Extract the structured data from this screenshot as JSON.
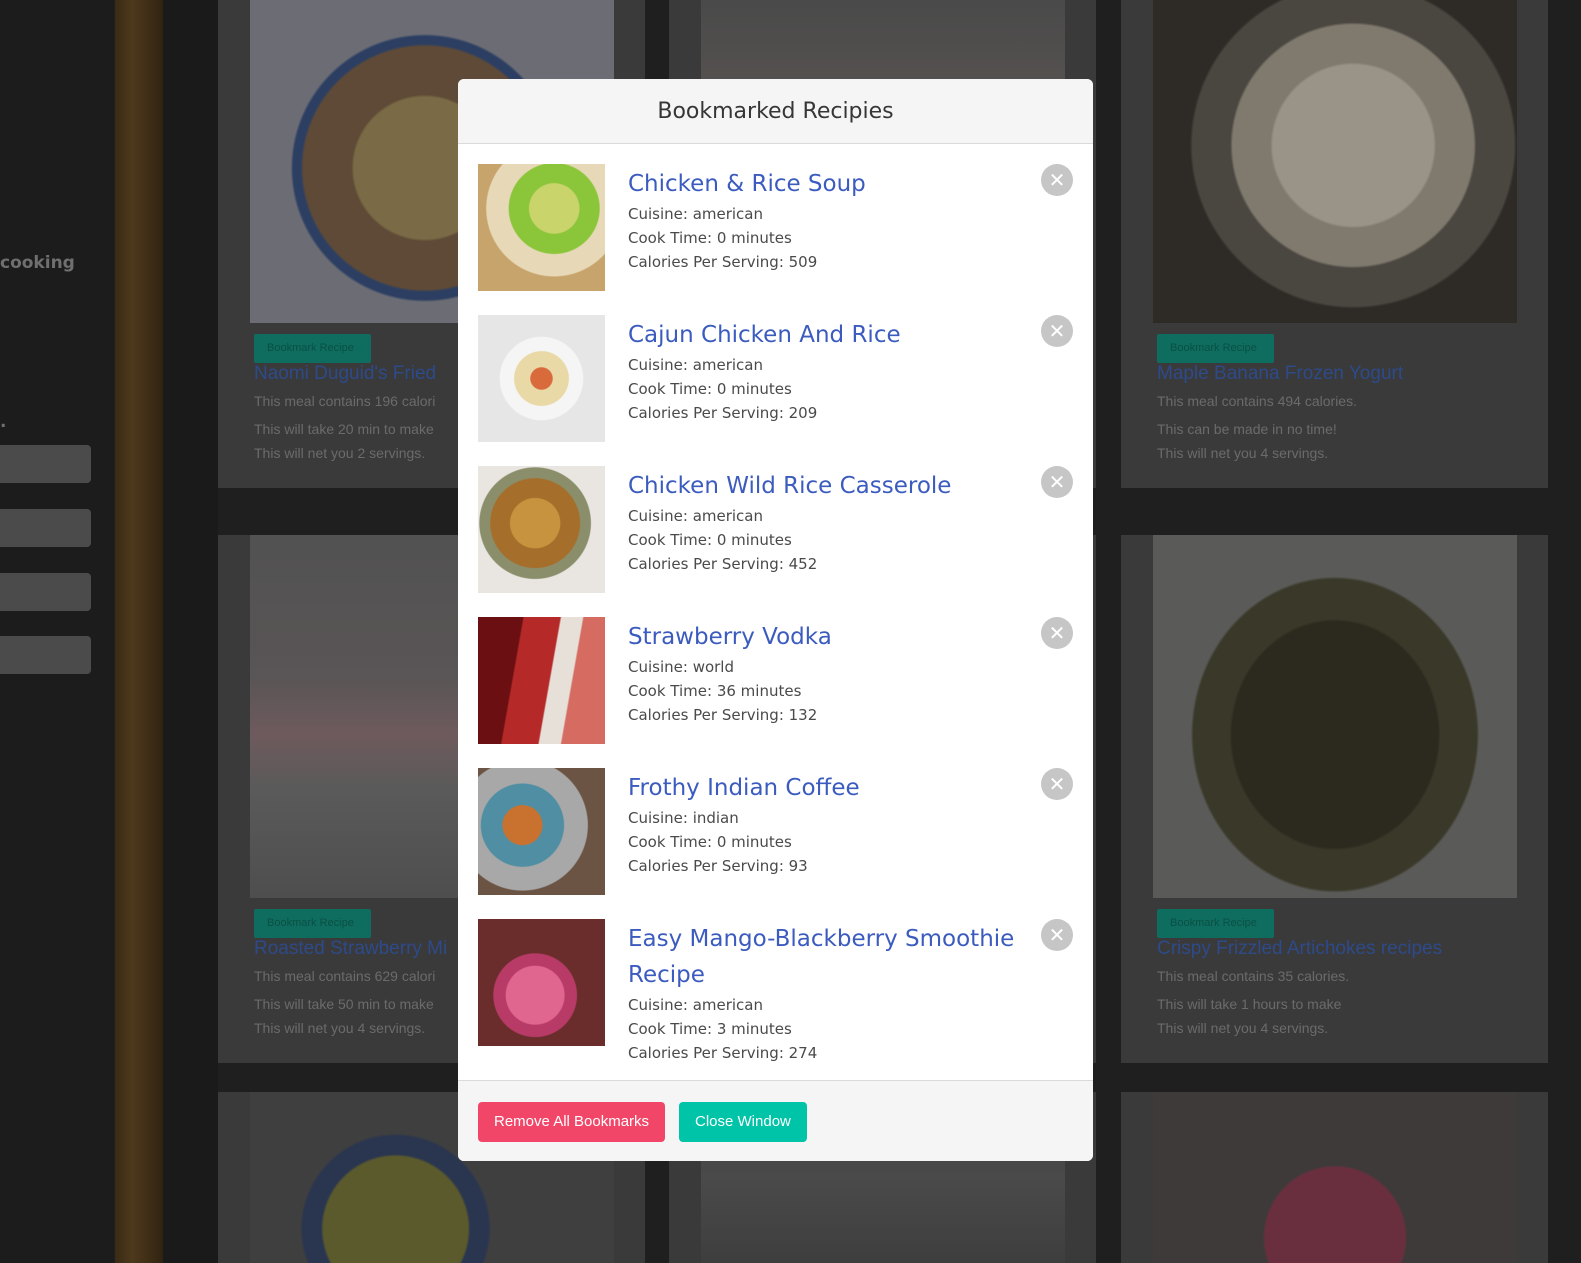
{
  "background": {
    "sidebar_word": "cooking",
    "sidebar_dot": ".",
    "cards": [
      {
        "button": "Bookmark Recipe",
        "title": "Naomi Duguid's Fried",
        "lines": [
          "This meal contains 196 calori",
          "This will take 20 min to make",
          "This will net you 2 servings."
        ]
      },
      {
        "button": "Bookmark Recipe",
        "title": "Maple Banana Frozen Yogurt",
        "lines": [
          "This meal contains 494 calories.",
          "This can be made in no time!",
          "This will net you 4 servings."
        ]
      },
      {
        "button": "Bookmark Recipe",
        "title": "Roasted Strawberry Mi",
        "lines": [
          "This meal contains 629 calori",
          "This will take 50 min to make",
          "This will net you 4 servings."
        ]
      },
      {
        "button": "Bookmark Recipe",
        "title": "Crispy Frizzled Artichokes recipes",
        "lines": [
          "This meal contains 35 calories.",
          "This will take 1 hours to make",
          "This will net you 4 servings."
        ]
      }
    ]
  },
  "modal": {
    "title": "Bookmarked Recipies",
    "close_glyph": "✕",
    "recipes": [
      {
        "title": "Chicken & Rice Soup",
        "cuisine": "Cuisine: american",
        "cook_time": "Cook Time: 0 minutes",
        "calories": "Calories Per Serving: 509"
      },
      {
        "title": "Cajun Chicken And Rice",
        "cuisine": "Cuisine: american",
        "cook_time": "Cook Time: 0 minutes",
        "calories": "Calories Per Serving: 209"
      },
      {
        "title": "Chicken Wild Rice Casserole",
        "cuisine": "Cuisine: american",
        "cook_time": "Cook Time: 0 minutes",
        "calories": "Calories Per Serving: 452"
      },
      {
        "title": "Strawberry Vodka",
        "cuisine": "Cuisine: world",
        "cook_time": "Cook Time: 36 minutes",
        "calories": "Calories Per Serving: 132"
      },
      {
        "title": "Frothy Indian Coffee",
        "cuisine": "Cuisine: indian",
        "cook_time": "Cook Time: 0 minutes",
        "calories": "Calories Per Serving: 93"
      },
      {
        "title": "Easy Mango-Blackberry Smoothie Recipe",
        "cuisine": "Cuisine: american",
        "cook_time": "Cook Time: 3 minutes",
        "calories": "Calories Per Serving: 274"
      }
    ],
    "footer": {
      "remove_all_label": "Remove All Bookmarks",
      "close_label": "Close Window"
    }
  },
  "colors": {
    "title_link": "#3b5bbf",
    "danger": "#f14668",
    "primary_teal": "#00c4a7"
  }
}
